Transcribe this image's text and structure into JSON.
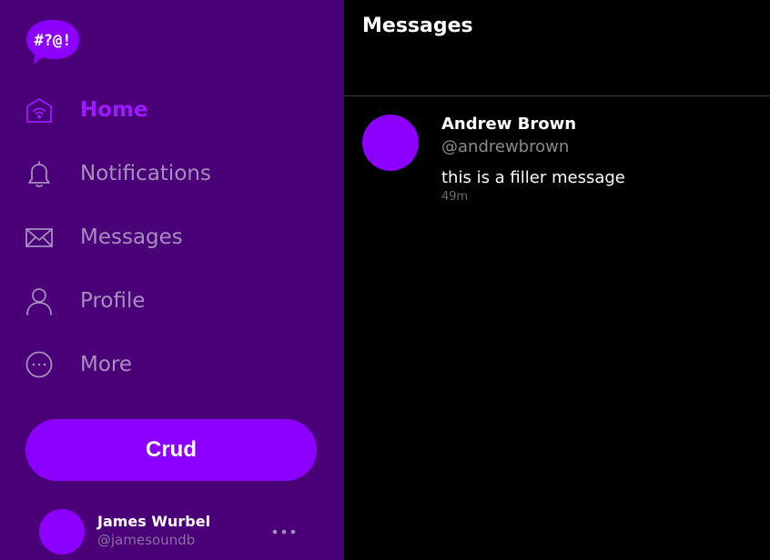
{
  "colors": {
    "sidebar_bg": "#4a0077",
    "accent": "#8c00ff",
    "active_nav": "#9d19ff",
    "inactive_nav": "#a88dc0",
    "main_bg": "#000000"
  },
  "logo": {
    "text": "#?@!",
    "icon": "speech-bubble-logo"
  },
  "nav": {
    "items": [
      {
        "label": "Home",
        "icon": "home-icon",
        "active": true
      },
      {
        "label": "Notifications",
        "icon": "bell-icon",
        "active": false
      },
      {
        "label": "Messages",
        "icon": "envelope-icon",
        "active": false
      },
      {
        "label": "Profile",
        "icon": "person-icon",
        "active": false
      },
      {
        "label": "More",
        "icon": "more-circle-icon",
        "active": false
      }
    ]
  },
  "compose": {
    "label": "Crud"
  },
  "current_user": {
    "name": "James Wurbel",
    "handle": "@jamesoundb"
  },
  "main": {
    "title": "Messages",
    "messages": [
      {
        "name": "Andrew Brown",
        "handle": "@andrewbrown",
        "text": "this is a filler message",
        "time": "49m"
      }
    ]
  }
}
